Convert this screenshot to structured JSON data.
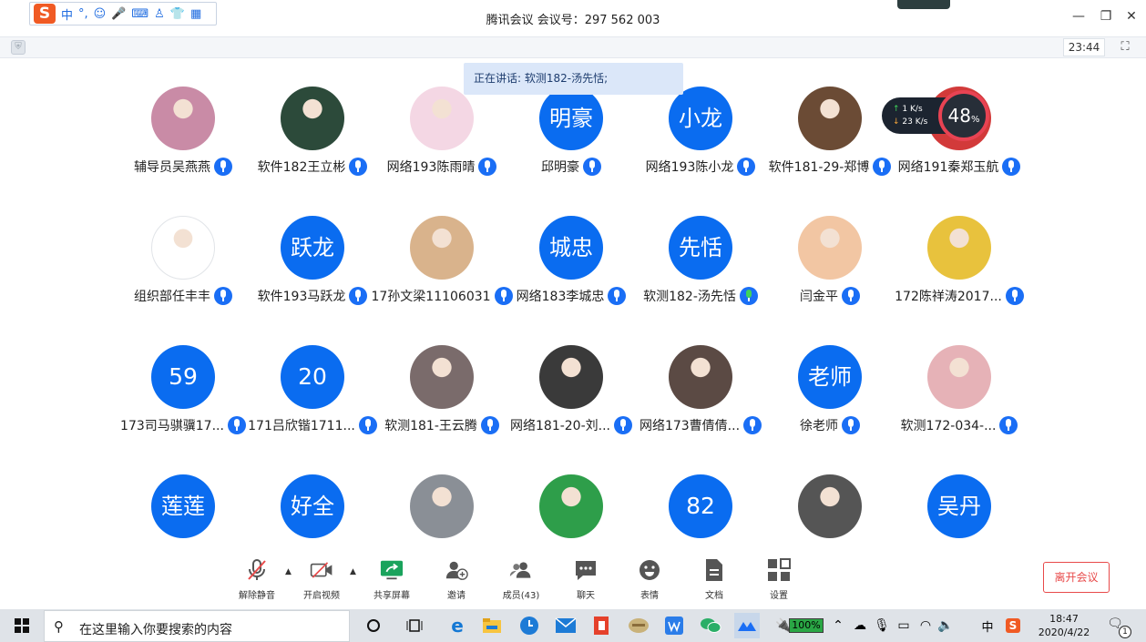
{
  "title": "腾讯会议 会议号：297 562 003",
  "ime": {
    "logo": "S",
    "lang": "中",
    "punct": "°,"
  },
  "meeting_time": "23:44",
  "speaking": "正在讲话: 软测182-汤先恬;",
  "net": {
    "up": "1   K/s",
    "down": "23  K/s",
    "percent": "48",
    "percent_unit": "%"
  },
  "participants": [
    {
      "name": "辅导员吴燕燕",
      "initials": "",
      "avatar": "photo"
    },
    {
      "name": "软件182王立彬",
      "initials": "",
      "avatar": "photo"
    },
    {
      "name": "网络193陈雨晴",
      "initials": "",
      "avatar": "photo"
    },
    {
      "name": "邱明豪",
      "initials": "明豪",
      "avatar": "blue"
    },
    {
      "name": "网络193陈小龙",
      "initials": "小龙",
      "avatar": "blue"
    },
    {
      "name": "软件181-29-郑博",
      "initials": "",
      "avatar": "photo"
    },
    {
      "name": "网络191秦郑玉航",
      "initials": "",
      "avatar": "photo"
    },
    {
      "name": "组织部任丰丰",
      "initials": "",
      "avatar": "photo"
    },
    {
      "name": "软件193马跃龙",
      "initials": "跃龙",
      "avatar": "blue"
    },
    {
      "name": "17孙文梁11106031",
      "initials": "",
      "avatar": "photo"
    },
    {
      "name": "网络183李城忠",
      "initials": "城忠",
      "avatar": "blue"
    },
    {
      "name": "软测182-汤先恬",
      "initials": "先恬",
      "avatar": "blue"
    },
    {
      "name": "闫金平",
      "initials": "",
      "avatar": "photo"
    },
    {
      "name": "172陈祥涛2017...",
      "initials": "",
      "avatar": "photo"
    },
    {
      "name": "173司马骐骥17...",
      "initials": "59",
      "avatar": "blue"
    },
    {
      "name": "171吕欣锴1711...",
      "initials": "20",
      "avatar": "blue"
    },
    {
      "name": "软测181-王云腾",
      "initials": "",
      "avatar": "photo"
    },
    {
      "name": "网络181-20-刘...",
      "initials": "",
      "avatar": "photo"
    },
    {
      "name": "网络173曹倩倩...",
      "initials": "",
      "avatar": "photo"
    },
    {
      "name": "徐老师",
      "initials": "老师",
      "avatar": "blue"
    },
    {
      "name": "软测172-034-...",
      "initials": "",
      "avatar": "photo"
    },
    {
      "name": "",
      "initials": "莲莲",
      "avatar": "blue"
    },
    {
      "name": "",
      "initials": "好全",
      "avatar": "blue"
    },
    {
      "name": "",
      "initials": "",
      "avatar": "photo"
    },
    {
      "name": "",
      "initials": "",
      "avatar": "photo"
    },
    {
      "name": "",
      "initials": "82",
      "avatar": "blue"
    },
    {
      "name": "",
      "initials": "",
      "avatar": "photo"
    },
    {
      "name": "",
      "initials": "吴丹",
      "avatar": "blue"
    }
  ],
  "toolbar": {
    "unmute": "解除静音",
    "video": "开启视频",
    "share": "共享屏幕",
    "invite": "邀请",
    "members": "成员(43)",
    "chat": "聊天",
    "emoji": "表情",
    "docs": "文档",
    "settings": "设置",
    "leave": "离开会议"
  },
  "taskbar": {
    "search_placeholder": "在这里输入你要搜索的内容",
    "battery": "100%",
    "ime_lang": "中",
    "time": "18:47",
    "date": "2020/4/22",
    "notifications": "1",
    "battery_level": 1.0
  },
  "colors": {
    "accent": "#0a6cf0",
    "leave": "#e84a4a"
  }
}
